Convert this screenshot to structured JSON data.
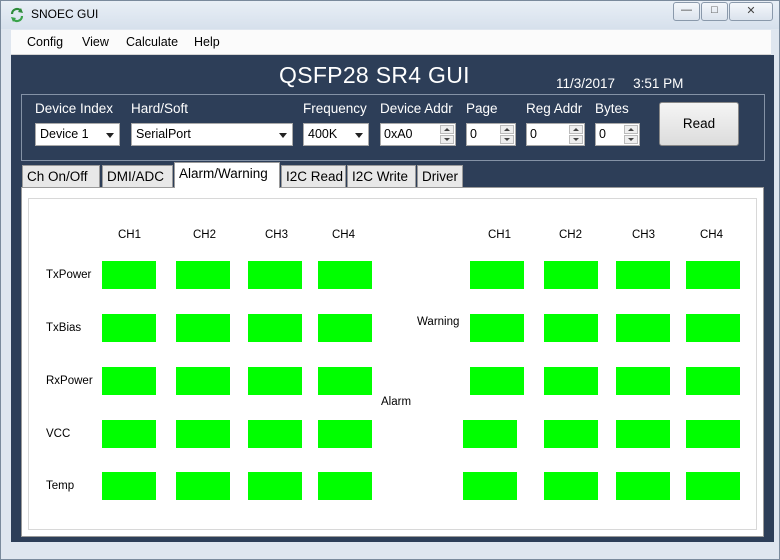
{
  "window": {
    "title": "SNOEC GUI"
  },
  "menu": [
    "Config",
    "View",
    "Calculate",
    "Help"
  ],
  "app_title": "QSFP28 SR4 GUI",
  "date": "11/3/2017",
  "time": "3:51 PM",
  "config": {
    "device_index": {
      "label": "Device Index",
      "value": "Device 1"
    },
    "hard_soft": {
      "label": "Hard/Soft",
      "value": "SerialPort"
    },
    "frequency": {
      "label": "Frequency",
      "value": "400K"
    },
    "device_addr": {
      "label": "Device Addr",
      "value": "0xA0"
    },
    "page": {
      "label": "Page",
      "value": "0"
    },
    "reg_addr": {
      "label": "Reg Addr",
      "value": "0"
    },
    "bytes": {
      "label": "Bytes",
      "value": "0"
    },
    "read_button": "Read"
  },
  "tabs": [
    "Ch On/Off",
    "DMI/ADC",
    "Alarm/Warning",
    "I2C Read",
    "I2C Write",
    "Driver"
  ],
  "active_tab": "Alarm/Warning",
  "alarm_warning": {
    "channels": [
      "CH1",
      "CH2",
      "CH3",
      "CH4"
    ],
    "rows": [
      "TxPower",
      "TxBias",
      "RxPower",
      "VCC",
      "Temp"
    ],
    "alarm_label": "Alarm",
    "warning_label": "Warning",
    "indicator_color": "#00ff00",
    "alarm_states": [
      [
        "ok",
        "ok",
        "ok",
        "ok"
      ],
      [
        "ok",
        "ok",
        "ok",
        "ok"
      ],
      [
        "ok",
        "ok",
        "ok",
        "ok"
      ],
      [
        "ok",
        "ok",
        "ok",
        "ok"
      ],
      [
        "ok",
        "ok",
        "ok",
        "ok"
      ]
    ],
    "warning_states": [
      [
        "ok",
        "ok",
        "ok",
        "ok"
      ],
      [
        "ok",
        "ok",
        "ok",
        "ok"
      ],
      [
        "ok",
        "ok",
        "ok",
        "ok"
      ],
      [
        "ok",
        "ok",
        "ok",
        "ok"
      ],
      [
        "ok",
        "ok",
        "ok",
        "ok"
      ]
    ]
  },
  "colors": {
    "panel_bg": "#2d3e58",
    "indicator_ok": "#00ff00"
  },
  "icons": {
    "app": "refresh-arrows-icon",
    "minimize": "minimize-icon",
    "maximize": "maximize-icon",
    "close": "close-icon"
  }
}
